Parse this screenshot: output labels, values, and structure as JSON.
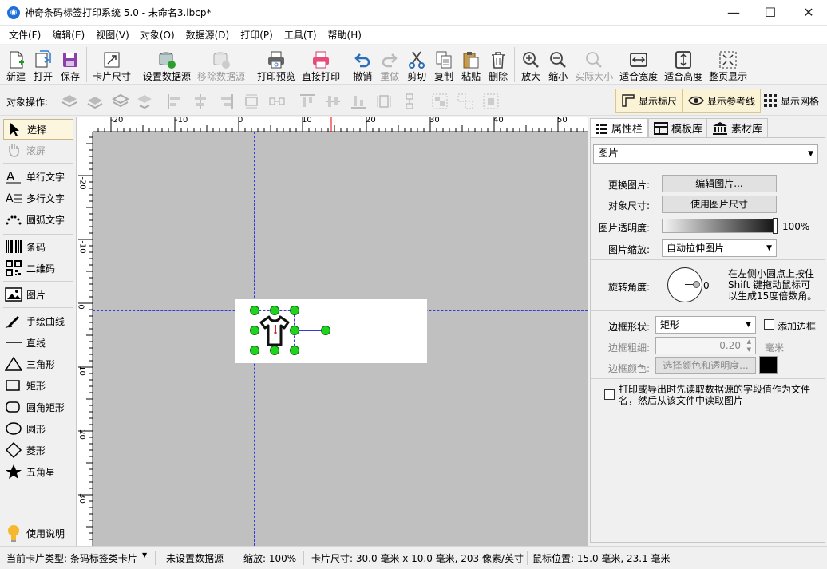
{
  "window": {
    "title": "神奇条码标签打印系统 5.0 - 未命名3.lbcp*",
    "app_icon": "app-logo-icon"
  },
  "menu": [
    "文件(F)",
    "编辑(E)",
    "视图(V)",
    "对象(O)",
    "数据源(D)",
    "打印(P)",
    "工具(T)",
    "帮助(H)"
  ],
  "toolbar": {
    "new": "新建",
    "open": "打开",
    "save": "保存",
    "card_size": "卡片尺寸",
    "set_datasource": "设置数据源",
    "remove_datasource": "移除数据源",
    "print_preview": "打印预览",
    "direct_print": "直接打印",
    "undo": "撤销",
    "redo": "重做",
    "cut": "剪切",
    "copy": "复制",
    "paste": "粘贴",
    "delete": "删除",
    "zoom_in": "放大",
    "zoom_out": "缩小",
    "actual_size": "实际大小",
    "fit_width": "适合宽度",
    "fit_height": "适合高度",
    "fit_page": "整页显示"
  },
  "ops": {
    "label": "对象操作:",
    "show_ruler": "显示标尺",
    "show_guides": "显示参考线",
    "show_grid": "显示网格"
  },
  "tools": {
    "select": "选择",
    "scroll": "滚屏",
    "single_text": "单行文字",
    "multi_text": "多行文字",
    "arc_text": "圆弧文字",
    "barcode": "条码",
    "qrcode": "二维码",
    "image": "图片",
    "freehand": "手绘曲线",
    "line": "直线",
    "triangle": "三角形",
    "rect": "矩形",
    "round_rect": "圆角矩形",
    "ellipse": "圆形",
    "diamond": "菱形",
    "star": "五角星",
    "help": "使用说明"
  },
  "ruler": {
    "h": [
      "-20",
      "-10",
      "0",
      "10",
      "20",
      "30",
      "40",
      "50"
    ],
    "v": [
      "0",
      "10",
      "20",
      "30"
    ],
    "v_top": [
      "-20",
      "-10"
    ]
  },
  "tabs": {
    "props": "属性栏",
    "templates": "模板库",
    "materials": "素材库"
  },
  "props": {
    "object_type": "图片",
    "change_image_label": "更换图片:",
    "edit_image_btn": "编辑图片...",
    "object_size_label": "对象尺寸:",
    "use_image_size_btn": "使用图片尺寸",
    "opacity_label": "图片透明度:",
    "opacity_value": "100%",
    "scale_label": "图片缩放:",
    "scale_value": "自动拉伸图片",
    "rotation_label": "旋转角度:",
    "rotation_value": "0",
    "rotation_hint": "在左侧小圆点上按住 Shift 键拖动鼠标可以生成15度倍数角。",
    "border_shape_label": "边框形状:",
    "border_shape_value": "矩形",
    "add_border": "添加边框",
    "border_width_label": "边框粗细:",
    "border_width_value": "0.20",
    "border_width_unit": "毫米",
    "border_color_label": "边框颜色:",
    "border_color_btn": "选择颜色和透明度...",
    "border_color": "#000000",
    "read_file_checkbox": "打印或导出时先读取数据源的字段值作为文件名，然后从该文件中读取图片"
  },
  "status": {
    "card_type": "当前卡片类型: 条码标签类卡片",
    "datasource": "未设置数据源",
    "zoom": "缩放: 100%",
    "card_size": "卡片尺寸: 30.0 毫米 x 10.0 毫米, 203 像素/英寸",
    "mouse_pos": "鼠标位置: 15.0 毫米, 23.1 毫米"
  }
}
